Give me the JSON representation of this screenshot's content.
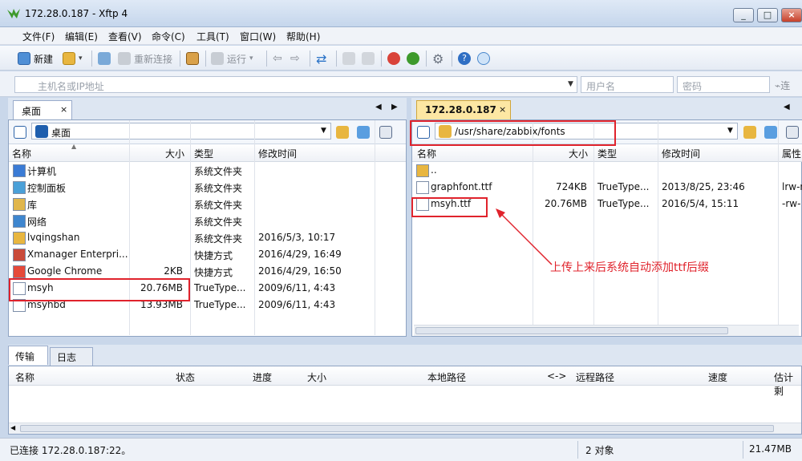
{
  "window": {
    "title": "172.28.0.187 - Xftp 4",
    "controls": [
      "_",
      "□",
      "×"
    ]
  },
  "menu": [
    "文件(F)",
    "编辑(E)",
    "查看(V)",
    "命令(C)",
    "工具(T)",
    "窗口(W)",
    "帮助(H)"
  ],
  "toolbar": {
    "new_label": "新建",
    "reconnect_label": "重新连接",
    "run_label": "运行"
  },
  "address": {
    "host_placeholder": "主机名或IP地址",
    "user_placeholder": "用户名",
    "password_placeholder": "密码",
    "connect_label": "连"
  },
  "left": {
    "tab": "桌面",
    "tab_close": "×",
    "path": "桌面",
    "columns": [
      "名称",
      "大小",
      "类型",
      "修改时间"
    ],
    "rows": [
      {
        "icon": "computer-icon",
        "name": "计算机",
        "size": "",
        "type": "系统文件夹",
        "modified": ""
      },
      {
        "icon": "control-panel-icon",
        "name": "控制面板",
        "size": "",
        "type": "系统文件夹",
        "modified": ""
      },
      {
        "icon": "library-icon",
        "name": "库",
        "size": "",
        "type": "系统文件夹",
        "modified": ""
      },
      {
        "icon": "network-icon",
        "name": "网络",
        "size": "",
        "type": "系统文件夹",
        "modified": ""
      },
      {
        "icon": "user-folder-icon",
        "name": "lvqingshan",
        "size": "",
        "type": "系统文件夹",
        "modified": "2016/5/3, 10:17"
      },
      {
        "icon": "xmanager-icon",
        "name": "Xmanager Enterpri...",
        "size": "",
        "type": "快捷方式",
        "modified": "2016/4/29, 16:49"
      },
      {
        "icon": "chrome-icon",
        "name": "Google Chrome",
        "size": "2KB",
        "type": "快捷方式",
        "modified": "2016/4/29, 16:50"
      },
      {
        "icon": "font-file-icon",
        "name": "msyh",
        "size": "20.76MB",
        "type": "TrueType...",
        "modified": "2009/6/11, 4:43"
      },
      {
        "icon": "font-file-icon",
        "name": "msyhbd",
        "size": "13.93MB",
        "type": "TrueType...",
        "modified": "2009/6/11, 4:43"
      }
    ]
  },
  "right": {
    "tab": "172.28.0.187",
    "tab_close": "×",
    "path": "/usr/share/zabbix/fonts",
    "columns": [
      "名称",
      "大小",
      "类型",
      "修改时间",
      "属性"
    ],
    "rows": [
      {
        "icon": "parent-folder-icon",
        "name": "..",
        "size": "",
        "type": "",
        "modified": "",
        "attr": ""
      },
      {
        "icon": "shortcut-file-icon",
        "name": "graphfont.ttf",
        "size": "724KB",
        "type": "TrueType...",
        "modified": "2013/8/25, 23:46",
        "attr": "lrw-r"
      },
      {
        "icon": "font-file-icon",
        "name": "msyh.ttf",
        "size": "20.76MB",
        "type": "TrueType...",
        "modified": "2016/5/4, 15:11",
        "attr": "-rw-"
      }
    ]
  },
  "annotation": {
    "text": "上传上来后系统自动添加ttf后缀",
    "color": "#e0232c"
  },
  "transfer": {
    "tabs": [
      "传输",
      "日志"
    ],
    "columns": [
      "名称",
      "状态",
      "进度",
      "大小",
      "本地路径",
      "<->",
      "远程路径",
      "速度",
      "估计剩"
    ]
  },
  "status": {
    "connection": "已连接 172.28.0.187:22。",
    "objects": "2 对象",
    "size": "21.47MB"
  }
}
